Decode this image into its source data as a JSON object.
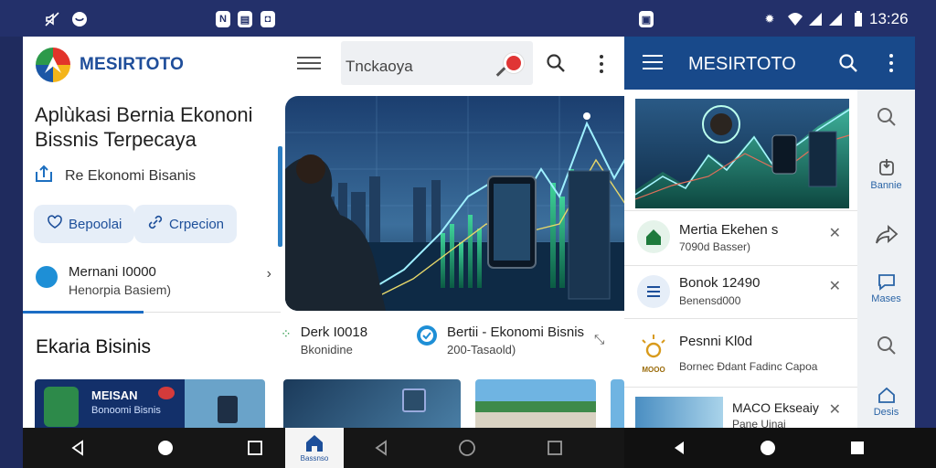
{
  "left_status": {
    "icons": [
      "mute-icon",
      "shield-icon",
      "notification-n-icon",
      "clipboard-icon",
      "lock-icon"
    ]
  },
  "left_app": {
    "brand": "MESIRTOTO",
    "search_text": "Tnckaoya",
    "headline": "Aplùkasi Bernia Ekononi Bissnis Terpecaya",
    "subline": "Re Ekonomi Bisanis",
    "chips": [
      "Bepoolai",
      "Crpecion"
    ],
    "card": {
      "title": "Mernani I0000",
      "sub": "Henorpia Basiem)"
    },
    "section_title": "Ekaria Bisinis",
    "banner": {
      "line1": "MEISAN",
      "line2": "Bonoomi Bisnis"
    },
    "news": [
      {
        "title": "Derk I0018",
        "sub": "Bkonidine"
      },
      {
        "title": "Bertii - Ekonomi Bisnis",
        "sub": "200-Tasaold)"
      }
    ],
    "home_label": "Bassnso"
  },
  "right_status": {
    "time": "13:26"
  },
  "right_app": {
    "title": "MESIRTOTO",
    "sidebar": [
      {
        "icon": "search-icon",
        "label": ""
      },
      {
        "icon": "download-icon",
        "label": "Bannie"
      },
      {
        "icon": "share-icon",
        "label": ""
      },
      {
        "icon": "chat-icon",
        "label": "Mases"
      },
      {
        "icon": "search-icon",
        "label": ""
      },
      {
        "icon": "home-icon",
        "label": "Desis"
      }
    ],
    "list": [
      {
        "title": "Mertia Ekehen s",
        "sub": "7090d Basser)"
      },
      {
        "title": "Bonok 12490",
        "sub": "Benensd000"
      },
      {
        "title": "Pesnni Kl0d",
        "sub": "Bornec Ðdant Fadinc Capoa",
        "logo": "MOOO"
      },
      {
        "title": "MACO Ekseaiy",
        "sub": "Pane Uinai"
      }
    ]
  },
  "colors": {
    "brand_blue": "#1f4e9a",
    "topbar": "#18498a",
    "status_bar": "#23306a"
  }
}
